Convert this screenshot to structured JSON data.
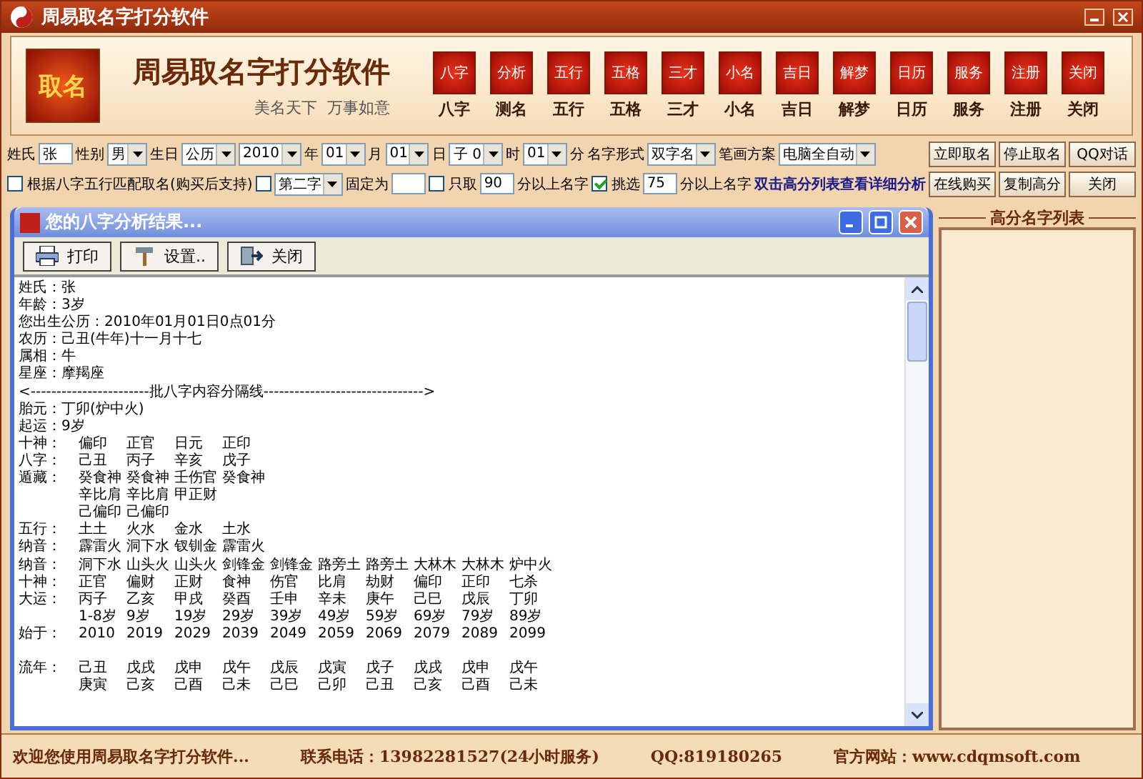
{
  "app_title": "周易取名字打分软件",
  "banner": {
    "logo_text": "取名",
    "title": "周易取名字打分软件",
    "slogan": "美名天下  万事如意",
    "tools": [
      {
        "icon_text": "八字",
        "label": "八字"
      },
      {
        "icon_text": "分析",
        "label": "测名"
      },
      {
        "icon_text": "五行",
        "label": "五行"
      },
      {
        "icon_text": "五格",
        "label": "五格"
      },
      {
        "icon_text": "三才",
        "label": "三才"
      },
      {
        "icon_text": "小名",
        "label": "小名"
      },
      {
        "icon_text": "吉日",
        "label": "吉日"
      },
      {
        "icon_text": "解梦",
        "label": "解梦"
      },
      {
        "icon_text": "日历",
        "label": "日历"
      },
      {
        "icon_text": "服务",
        "label": "服务"
      },
      {
        "icon_text": "注册",
        "label": "注册"
      },
      {
        "icon_text": "关闭",
        "label": "关闭"
      }
    ]
  },
  "form_rows": [
    [
      {
        "kind": "label",
        "text": "姓氏"
      },
      {
        "kind": "input",
        "value": "张"
      },
      {
        "kind": "label",
        "text": "性别"
      },
      {
        "kind": "select",
        "value": "男"
      },
      {
        "kind": "label",
        "text": "生日"
      },
      {
        "kind": "select",
        "value": "公历"
      },
      {
        "kind": "select",
        "value": "2010"
      },
      {
        "kind": "label",
        "text": "年"
      },
      {
        "kind": "select",
        "value": "01"
      },
      {
        "kind": "label",
        "text": "月"
      },
      {
        "kind": "select",
        "value": "01"
      },
      {
        "kind": "label",
        "text": "日"
      },
      {
        "kind": "select",
        "value": "子 0"
      },
      {
        "kind": "label",
        "text": "时"
      },
      {
        "kind": "select",
        "value": "01"
      },
      {
        "kind": "label",
        "text": "分"
      },
      {
        "kind": "label",
        "text": "名字形式"
      },
      {
        "kind": "select",
        "value": "双字名"
      },
      {
        "kind": "label",
        "text": "笔画方案"
      },
      {
        "kind": "select",
        "value": "电脑全自动"
      },
      {
        "kind": "button",
        "text": "立即取名"
      },
      {
        "kind": "button",
        "text": "停止取名"
      },
      {
        "kind": "button",
        "text": "QQ对话"
      }
    ],
    [
      {
        "kind": "checkbox",
        "text": "根据八字五行匹配取名(购买后支持)",
        "checked": false
      },
      {
        "kind": "checkbox",
        "checked": false
      },
      {
        "kind": "select",
        "value": "第二字"
      },
      {
        "kind": "label",
        "text": "固定为"
      },
      {
        "kind": "input"
      },
      {
        "kind": "checkbox",
        "text": "只取",
        "checked": false
      },
      {
        "kind": "input",
        "value": "90"
      },
      {
        "kind": "label",
        "text": "分以上名字"
      },
      {
        "kind": "checkbox",
        "text": "挑选",
        "checked": true
      },
      {
        "kind": "input",
        "value": "75"
      },
      {
        "kind": "label",
        "text": "分以上名字"
      },
      {
        "kind": "link",
        "text": "双击高分列表查看详细分析"
      },
      {
        "kind": "button",
        "text": "在线购买"
      },
      {
        "kind": "button",
        "text": "复制高分"
      },
      {
        "kind": "button",
        "text": "关闭"
      }
    ]
  ],
  "dialog": {
    "title": "您的八字分析结果...",
    "toolbar": [
      {
        "kind": "print",
        "text": "打印"
      },
      {
        "kind": "settings",
        "text": "设置.."
      },
      {
        "kind": "exit",
        "text": "关闭"
      }
    ],
    "lines": [
      {
        "kind": "text",
        "text": "姓氏：张"
      },
      {
        "kind": "text",
        "text": "年龄：3岁"
      },
      {
        "kind": "text",
        "text": "您出生公历：2010年01月01日0点01分"
      },
      {
        "kind": "text",
        "text": "农历：己丑(牛年)十一月十七"
      },
      {
        "kind": "text",
        "text": "属相：牛"
      },
      {
        "kind": "text",
        "text": "星座：摩羯座"
      },
      {
        "kind": "text",
        "text": "<-----------------------批八字内容分隔线------------------------------->"
      },
      {
        "kind": "text",
        "text": "胎元：丁卯(炉中火)"
      },
      {
        "kind": "text",
        "text": "起运：9岁"
      },
      {
        "kind": "row",
        "label": "十神：",
        "cells": [
          "偏印",
          "正官",
          "日元",
          "正印"
        ]
      },
      {
        "kind": "row",
        "label": "八字：",
        "cells": [
          "己丑",
          "丙子",
          "辛亥",
          "戊子"
        ]
      },
      {
        "kind": "row",
        "label": "遁藏：",
        "cells": [
          "癸食神",
          "癸食神",
          "壬伤官",
          "癸食神"
        ]
      },
      {
        "kind": "row",
        "cells": [
          "辛比肩",
          "辛比肩",
          "甲正财"
        ]
      },
      {
        "kind": "row",
        "cells": [
          "己偏印",
          "己偏印"
        ]
      },
      {
        "kind": "row",
        "label": "五行：",
        "cells": [
          "土土",
          "火水",
          "金水",
          "土水"
        ]
      },
      {
        "kind": "row",
        "label": "纳音：",
        "cells": [
          "霹雷火",
          "洞下水",
          "钗钏金",
          "霹雷火"
        ]
      },
      {
        "kind": "row",
        "label": "纳音：",
        "cells": [
          "洞下水",
          "山头火",
          "山头火",
          "剑锋金",
          "剑锋金",
          "路旁土",
          "路旁土",
          "大林木",
          "大林木",
          "炉中火"
        ]
      },
      {
        "kind": "row",
        "label": "十神：",
        "cells": [
          "正官",
          "偏财",
          "正财",
          "食神",
          "伤官",
          "比肩",
          "劫财",
          "偏印",
          "正印",
          "七杀"
        ]
      },
      {
        "kind": "row",
        "label": "大运：",
        "cells": [
          "丙子",
          "乙亥",
          "甲戌",
          "癸酉",
          "壬申",
          "辛未",
          "庚午",
          "己巳",
          "戊辰",
          "丁卯"
        ]
      },
      {
        "kind": "row",
        "cells": [
          "1-8岁",
          "9岁",
          "19岁",
          "29岁",
          "39岁",
          "49岁",
          "59岁",
          "69岁",
          "79岁",
          "89岁"
        ]
      },
      {
        "kind": "row",
        "label": "始于：",
        "cells": [
          "2010",
          "2019",
          "2029",
          "2039",
          "2049",
          "2059",
          "2069",
          "2079",
          "2089",
          "2099"
        ]
      },
      {
        "kind": "blank"
      },
      {
        "kind": "row",
        "label": "流年：",
        "cells": [
          "己丑",
          "戊戌",
          "戊申",
          "戊午",
          "戊辰",
          "戊寅",
          "戊子",
          "戊戌",
          "戊申",
          "戊午"
        ]
      },
      {
        "kind": "row",
        "cells": [
          "庚寅",
          "己亥",
          "己酉",
          "己未",
          "己巳",
          "己卯",
          "己丑",
          "己亥",
          "己酉",
          "己未"
        ]
      }
    ]
  },
  "side_panel": {
    "title": "高分名字列表"
  },
  "status_bar": [
    "欢迎您使用周易取名字打分软件...",
    "联系电话：13982281527(24小时服务)",
    "QQ:819180265",
    "官方网站：www.cdqmsoft.com"
  ]
}
